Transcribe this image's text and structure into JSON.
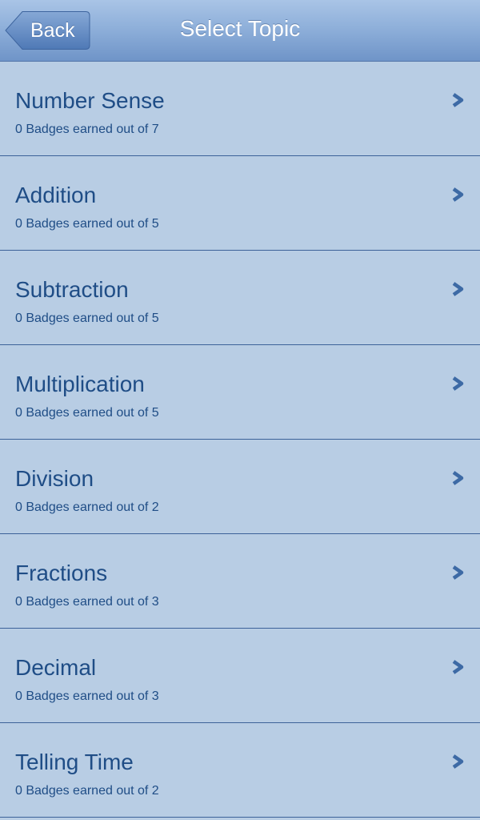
{
  "nav": {
    "back_label": "Back",
    "title": "Select Topic"
  },
  "colors": {
    "background": "#b8cde4",
    "text": "#1f4d86",
    "divider": "#3c6299",
    "nav_bar": "#7fa3d2"
  },
  "topics": [
    {
      "title": "Number Sense",
      "subtitle": "0 Badges earned out of 7"
    },
    {
      "title": "Addition",
      "subtitle": "0 Badges earned out of 5"
    },
    {
      "title": "Subtraction",
      "subtitle": "0 Badges earned out of 5"
    },
    {
      "title": "Multiplication",
      "subtitle": "0 Badges earned out of 5"
    },
    {
      "title": "Division",
      "subtitle": "0 Badges earned out of 2"
    },
    {
      "title": "Fractions",
      "subtitle": "0 Badges earned out of 3"
    },
    {
      "title": "Decimal",
      "subtitle": "0 Badges earned out of 3"
    },
    {
      "title": "Telling Time",
      "subtitle": "0 Badges earned out of 2"
    }
  ],
  "row_icon": "chevron-right-icon"
}
